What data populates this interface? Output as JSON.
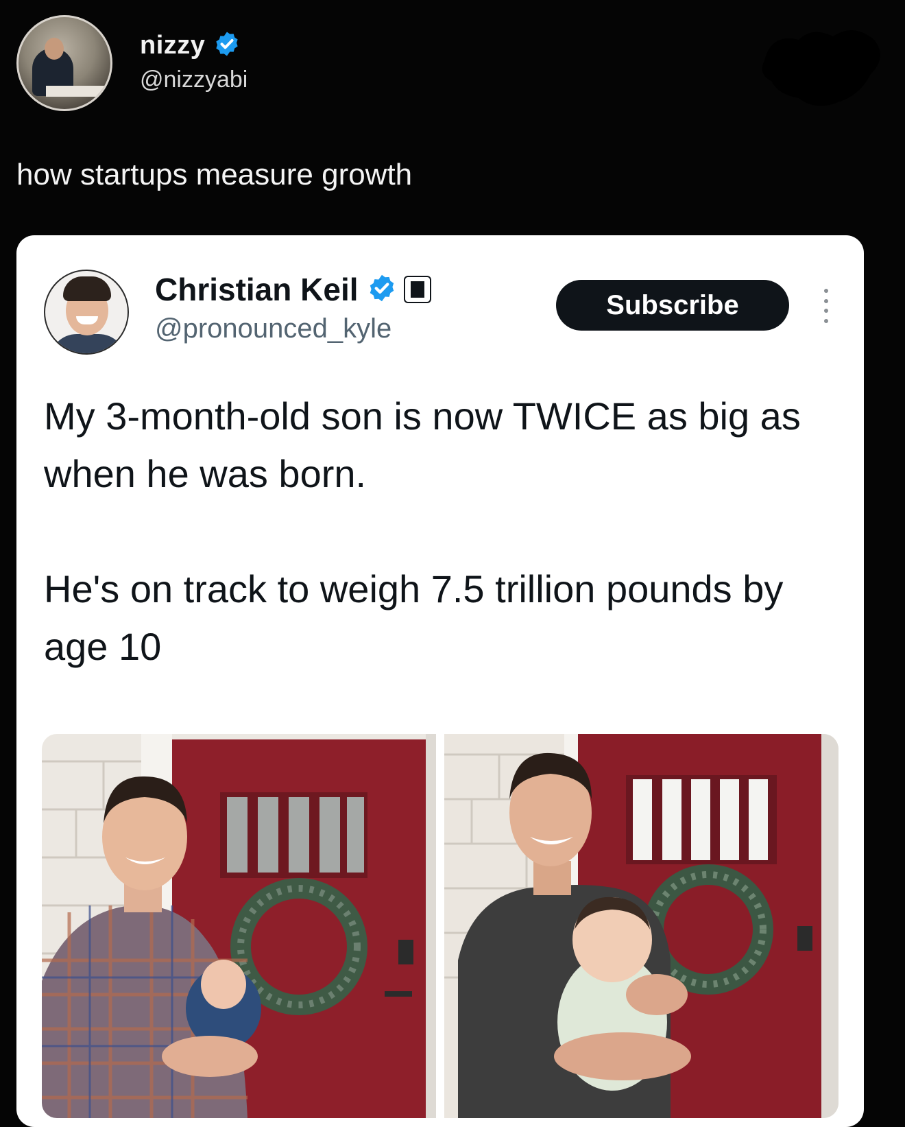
{
  "outer_post": {
    "author_name": "nizzy",
    "author_handle": "@nizzyabi",
    "text": "how startups measure growth"
  },
  "quoted_post": {
    "author_name": "Christian Keil",
    "author_handle": "@pronounced_kyle",
    "subscribe_label": "Subscribe",
    "text_paragraph_1": "My 3-month-old son is now TWICE as big as when he was born.",
    "text_paragraph_2": "He's on track to weigh 7.5 trillion pounds by age 10"
  },
  "colors": {
    "background": "#050505",
    "card": "#ffffff",
    "verified_blue": "#1d9bf0",
    "door_red": "#8e1f2a"
  },
  "icons": {
    "verified": "verified-badge-icon",
    "affiliate": "affiliate-badge-icon",
    "more": "more-options-icon"
  }
}
